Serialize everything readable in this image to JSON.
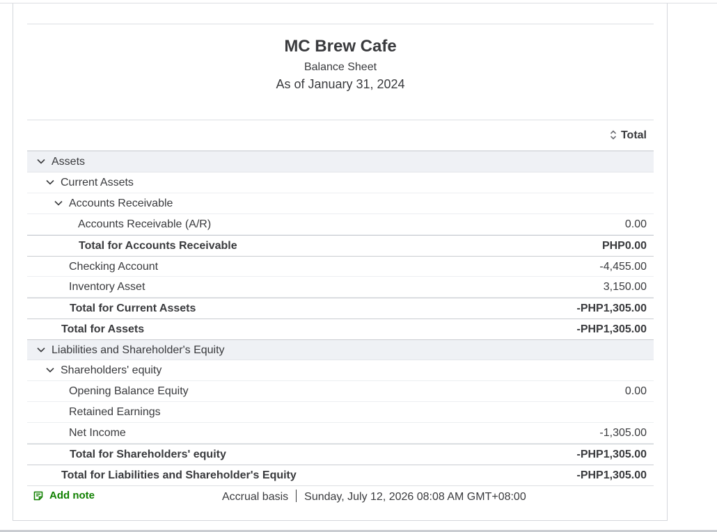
{
  "header": {
    "company": "MC Brew Cafe",
    "report_type": "Balance Sheet",
    "as_of": "As of January 31, 2024"
  },
  "columns": {
    "total": "Total"
  },
  "rows": {
    "assets": {
      "label": "Assets"
    },
    "current_assets": {
      "label": "Current Assets"
    },
    "accounts_receivable": {
      "label": "Accounts Receivable"
    },
    "ar": {
      "label": "Accounts Receivable (A/R)",
      "amount": "0.00"
    },
    "total_ar": {
      "label": "Total for Accounts Receivable",
      "amount": "PHP0.00"
    },
    "checking": {
      "label": "Checking Account",
      "amount": "-4,455.00"
    },
    "inventory": {
      "label": "Inventory Asset",
      "amount": "3,150.00"
    },
    "total_current_assets": {
      "label": "Total for Current Assets",
      "amount": "-PHP1,305.00"
    },
    "total_assets": {
      "label": "Total for Assets",
      "amount": "-PHP1,305.00"
    },
    "liabilities_equity": {
      "label": "Liabilities and Shareholder's Equity"
    },
    "shareholders_equity": {
      "label": "Shareholders' equity"
    },
    "opening_balance": {
      "label": "Opening Balance Equity",
      "amount": "0.00"
    },
    "retained_earnings": {
      "label": "Retained Earnings",
      "amount": ""
    },
    "net_income": {
      "label": "Net Income",
      "amount": "-1,305.00"
    },
    "total_shareholders_equity": {
      "label": "Total for Shareholders' equity",
      "amount": "-PHP1,305.00"
    },
    "total_liabilities_equity": {
      "label": "Total for Liabilities and Shareholder's Equity",
      "amount": "-PHP1,305.00"
    }
  },
  "footer": {
    "add_note": "Add note",
    "basis": "Accrual basis",
    "timestamp": "Sunday, July 12, 2026 08:08 AM GMT+08:00"
  },
  "colors": {
    "accent_green": "#108000",
    "text": "#393a3d",
    "section_bg": "#eff1f5"
  },
  "icons": {
    "collapse": "chevron-down-icon",
    "sort": "sort-icon",
    "note": "note-icon"
  }
}
